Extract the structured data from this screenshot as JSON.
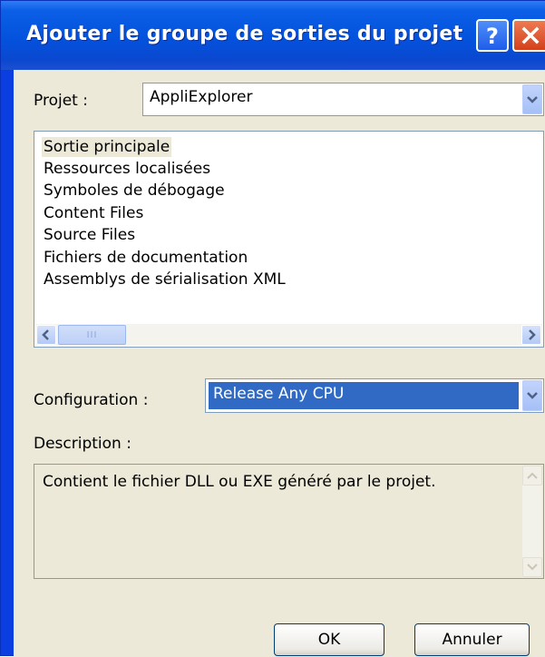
{
  "window": {
    "title": "Ajouter le groupe de sorties du projet"
  },
  "project": {
    "label": "Projet :",
    "value": "AppliExplorer"
  },
  "outputs": {
    "items": [
      "Sortie principale",
      "Ressources localisées",
      "Symboles de débogage",
      "Content Files",
      "Source Files",
      "Fichiers de documentation",
      "Assemblys de sérialisation XML"
    ],
    "selected_item": "Sortie principale",
    "scrollbar_grip": "III"
  },
  "configuration": {
    "label": "Configuration :",
    "value": "Release Any CPU"
  },
  "description": {
    "label": "Description :",
    "text": "Contient le fichier DLL ou EXE généré par le projet."
  },
  "buttons": {
    "ok": "OK",
    "cancel": "Annuler"
  },
  "icons": {
    "help": "help-icon",
    "close": "close-icon",
    "dropdown": "chevron-down-icon",
    "scroll_left": "arrow-left-icon",
    "scroll_right": "arrow-right-icon",
    "scroll_up": "arrow-up-icon",
    "scroll_down": "arrow-down-icon"
  },
  "colors": {
    "title_bar": "#0452dd",
    "dialog_background": "#ece9d8",
    "selection_highlight": "#316ac5",
    "close_button": "#d2411b"
  }
}
